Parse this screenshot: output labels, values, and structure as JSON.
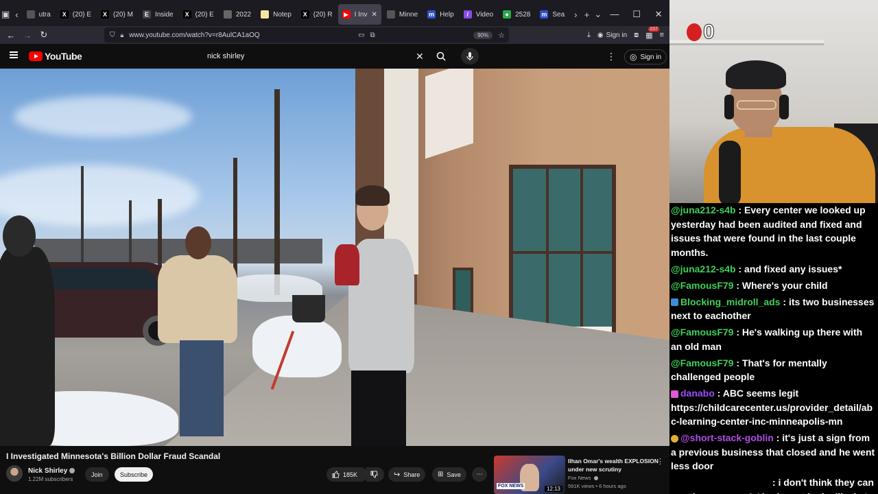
{
  "browser": {
    "tabs": [
      {
        "label": "utra",
        "fav": "",
        "color": "#555"
      },
      {
        "label": "(20) E",
        "fav": "X",
        "color": "#000"
      },
      {
        "label": "(20) M",
        "fav": "X",
        "color": "#000"
      },
      {
        "label": "Inside",
        "fav": "E",
        "color": "#444"
      },
      {
        "label": "(20) E",
        "fav": "X",
        "color": "#000"
      },
      {
        "label": "2022",
        "fav": "",
        "color": "#666"
      },
      {
        "label": "Notep",
        "fav": "",
        "color": "#f2e6a0"
      },
      {
        "label": "(20) R",
        "fav": "X",
        "color": "#000"
      },
      {
        "label": "I Inv",
        "fav": "▶",
        "color": "#ff0000"
      },
      {
        "label": "Minne",
        "fav": "",
        "color": "#555"
      },
      {
        "label": "Help",
        "fav": "m",
        "color": "#3050d0"
      },
      {
        "label": "Video",
        "fav": "/",
        "color": "#8a4ae8"
      },
      {
        "label": "2528",
        "fav": "●",
        "color": "#2aa84a"
      },
      {
        "label": "Sea",
        "fav": "m",
        "color": "#3050d0"
      }
    ],
    "url": "www.youtube.com/watch?v=r8AulCA1aOQ",
    "zoom": "90%",
    "signin_label": "Sign in",
    "ext_badge": "157"
  },
  "youtube": {
    "logo_text": "YouTube",
    "search_value": "nick shirley",
    "signin_label": "Sign in",
    "video_title": "I Investigated Minnesota's Billion Dollar Fraud Scandal",
    "channel_name": "Nick Shirley",
    "channel_subs": "1.22M subscribers",
    "join_label": "Join",
    "subscribe_label": "Subscribe",
    "like_count": "185K",
    "share_label": "Share",
    "save_label": "Save"
  },
  "recommendation": {
    "title": "Ilhan Omar's wealth EXPLOSION under new scrutiny",
    "channel": "Fox News",
    "meta": "591K views • 6 hours ago",
    "duration": "12:13",
    "thumb_label": "FOX NEWS"
  },
  "overlay": {
    "counter": "0"
  },
  "chat": [
    {
      "user": "@juna212-s4b",
      "text": "Every center we looked up yesterday had been audited and fixed and issues that were found in the last couple months.",
      "color": "green",
      "badge": ""
    },
    {
      "user": "@juna212-s4b",
      "text": "and fixed any issues*",
      "color": "green",
      "badge": ""
    },
    {
      "user": "@FamousF79",
      "text": "Where's your child",
      "color": "green",
      "badge": ""
    },
    {
      "user": "Blocking_midroll_ads",
      "text": "its two businesses next to eachother",
      "color": "green",
      "badge": "blue"
    },
    {
      "user": "@FamousF79",
      "text": "He's walking up there with an old man",
      "color": "green",
      "badge": ""
    },
    {
      "user": "@FamousF79",
      "text": "That's for mentally challenged people",
      "color": "green",
      "badge": ""
    },
    {
      "user": "danabo",
      "text": "ABC seems legit https://childcarecenter.us/provider_detail/abc-learning-center-inc-minneapolis-mn",
      "color": "purple",
      "badge": "pink"
    },
    {
      "user": "@short-stack-goblin",
      "text": "it's just a sign from a previous business that closed and he went less door",
      "color": "purple2",
      "badge": "gold"
    },
    {
      "user": "",
      "text": "i don't think they can see the camera, @Ahrelevant looks like he's using the meta glasses with the camera in it",
      "color": "green",
      "badge": ""
    }
  ]
}
